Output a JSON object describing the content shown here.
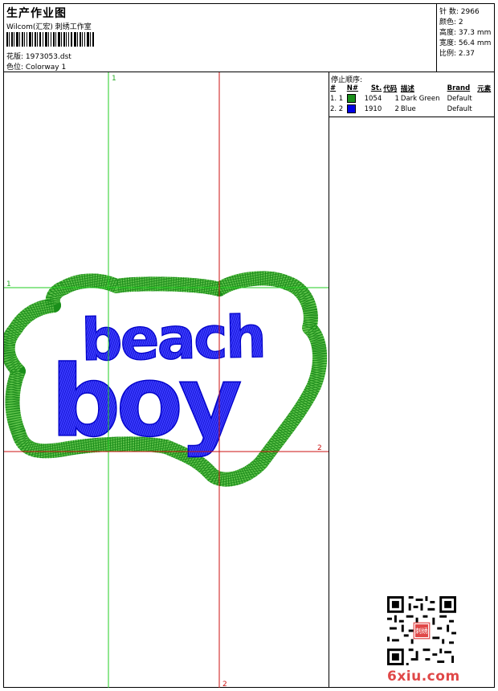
{
  "header": {
    "title": "生产作业图",
    "company": "Wilcom(汇宏) 刺绣工作室",
    "design_label": "花版:",
    "design_value": "1973053.dst",
    "colorway_label": "色位:",
    "colorway_value": "Colorway 1"
  },
  "stats": {
    "stitches_label": "针 数:",
    "stitches_value": "2966",
    "colors_label": "颜色:",
    "colors_value": "2",
    "height_label": "高度:",
    "height_value": "37.3 mm",
    "width_label": "宽度:",
    "width_value": "56.4 mm",
    "ratio_label": "比例:",
    "ratio_value": "2.37"
  },
  "stops": {
    "title": "停止顺序:",
    "columns": [
      "#",
      "N#",
      "St.",
      "代码",
      "描述",
      "Brand",
      "元素"
    ],
    "rows": [
      {
        "idx": "1. 1",
        "stitches": "1054",
        "code": "1",
        "desc": "Dark Green",
        "brand": "Default",
        "color": "#1a8f1a"
      },
      {
        "idx": "2. 2",
        "stitches": "1910",
        "code": "2",
        "desc": "Blue",
        "brand": "Default",
        "color": "#0000e6"
      }
    ]
  },
  "guides": {
    "v1": "1",
    "v2": "2",
    "h1": "1",
    "h2": "2"
  },
  "design": {
    "line1": "beach",
    "line2": "boy",
    "outline_color": "#2e9a1e",
    "fill_color": "#1414e0"
  },
  "watermark": {
    "site": "6xiu.com",
    "seal": "刺绣"
  }
}
